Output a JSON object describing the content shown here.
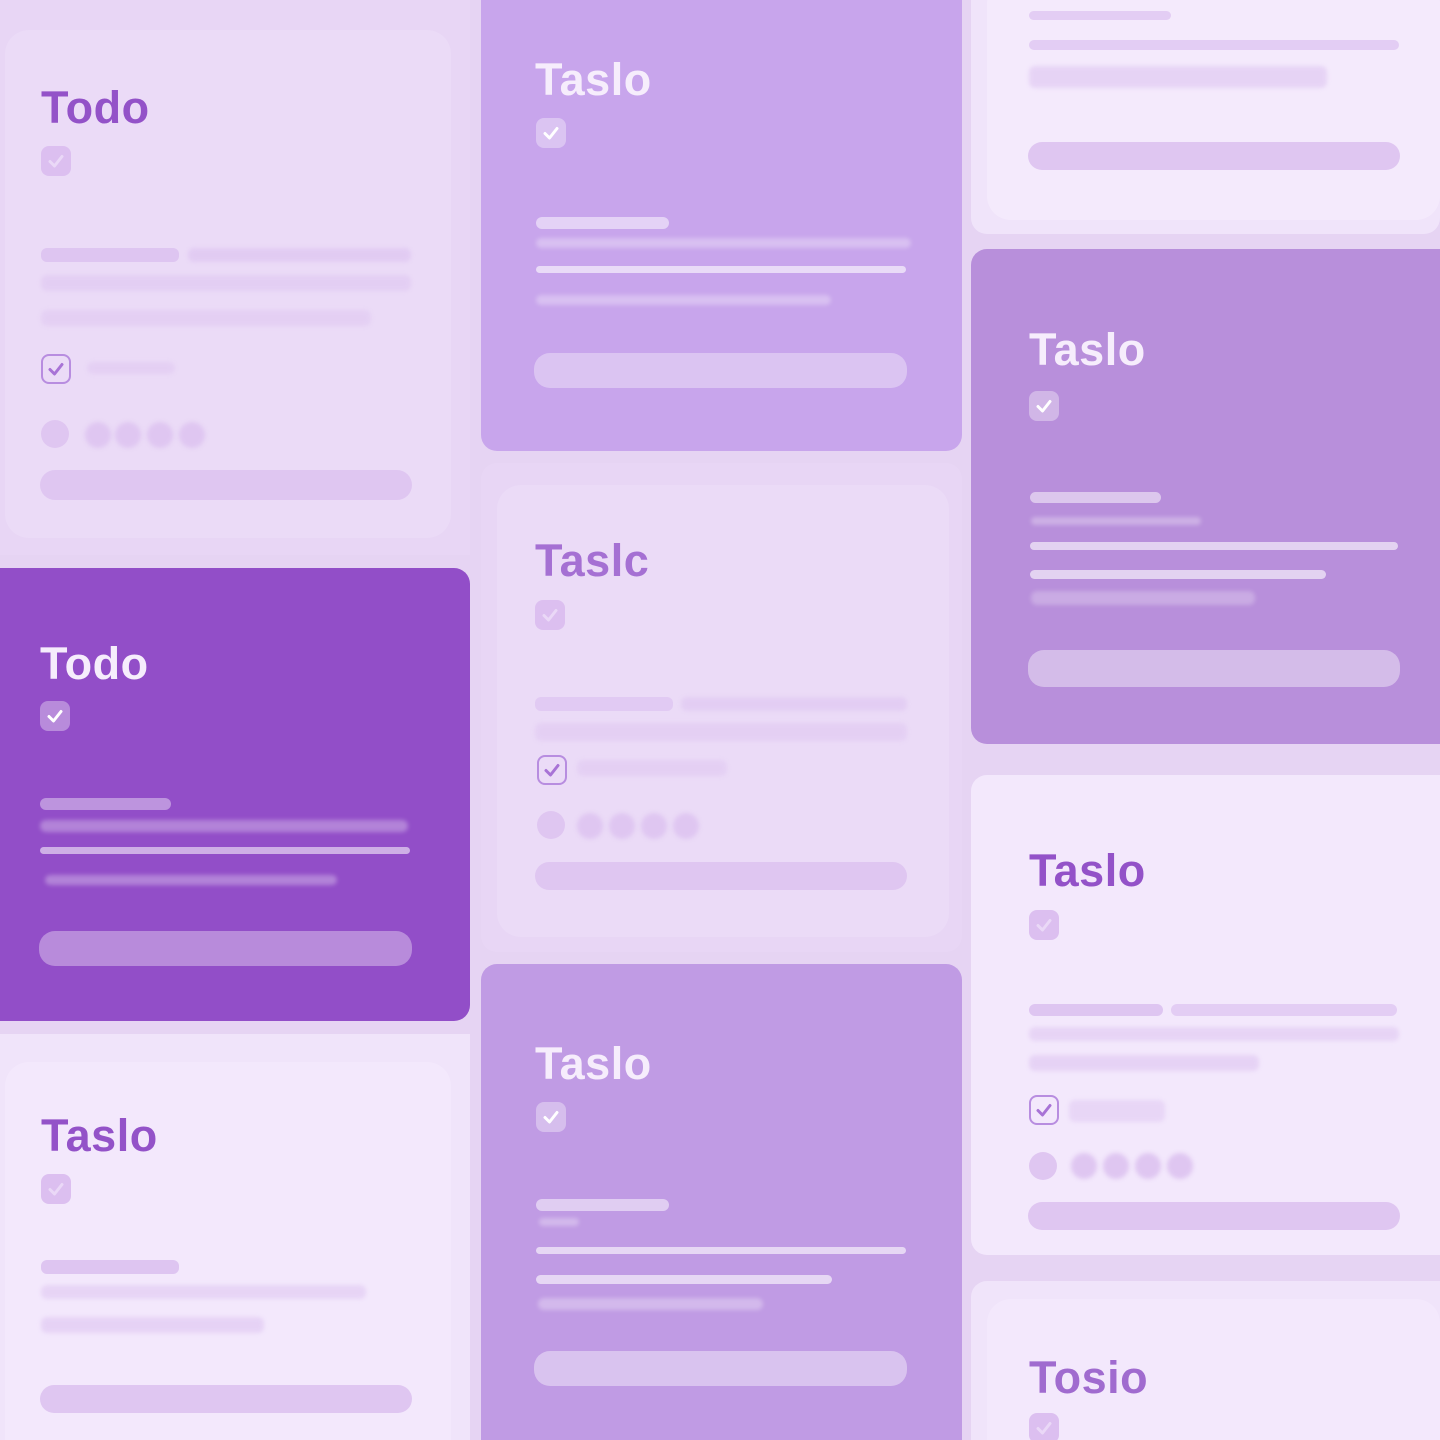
{
  "colors": {
    "background": "#e6d4f3",
    "accent_dark": "#924ec8",
    "accent_mid": "#c09be4",
    "accent_light": "#ebdcf7"
  },
  "cards": [
    {
      "id": "c1",
      "title": "Todo",
      "icon": "checkbox-icon"
    },
    {
      "id": "c2",
      "title": "Taslo",
      "icon": "checkbox-icon"
    },
    {
      "id": "c3",
      "title": "",
      "icon": ""
    },
    {
      "id": "c4",
      "title": "Todo",
      "icon": "checkbox-icon"
    },
    {
      "id": "c5",
      "title": "Taslc",
      "icon": "checkbox-icon"
    },
    {
      "id": "c6",
      "title": "Taslo",
      "icon": "checkbox-icon"
    },
    {
      "id": "c7",
      "title": "Taslo",
      "icon": "checkbox-icon"
    },
    {
      "id": "c8",
      "title": "Taslo",
      "icon": "checkbox-icon"
    },
    {
      "id": "c9",
      "title": "Taslo",
      "icon": "checkbox-icon"
    },
    {
      "id": "c10",
      "title": "Tosio",
      "icon": "checkbox-icon"
    }
  ]
}
